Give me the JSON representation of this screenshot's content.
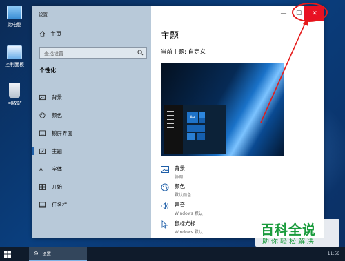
{
  "desktop": {
    "icons": [
      {
        "label": "此电脑",
        "icon": "computer-icon"
      },
      {
        "label": "控制面板",
        "icon": "control-panel-icon"
      },
      {
        "label": "回收站",
        "icon": "recycle-bin-icon"
      }
    ]
  },
  "window": {
    "title": "设置",
    "controls": {
      "minimize": "—",
      "maximize": "☐",
      "close": "✕"
    }
  },
  "sidebar": {
    "home_label": "主页",
    "search_placeholder": "查找设置",
    "category": "个性化",
    "items": [
      {
        "label": "背景",
        "icon": "image-icon"
      },
      {
        "label": "颜色",
        "icon": "palette-icon"
      },
      {
        "label": "锁屏界面",
        "icon": "lock-screen-icon"
      },
      {
        "label": "主题",
        "icon": "theme-icon",
        "active": true
      },
      {
        "label": "字体",
        "icon": "font-icon"
      },
      {
        "label": "开始",
        "icon": "start-icon"
      },
      {
        "label": "任务栏",
        "icon": "taskbar-icon"
      }
    ]
  },
  "content": {
    "title": "主题",
    "current_theme": "当前主题: 自定义",
    "preview_text": "Aa",
    "settings": [
      {
        "label": "背景",
        "value": "协调",
        "icon": "image-icon"
      },
      {
        "label": "颜色",
        "value": "默认颜色",
        "icon": "palette-icon"
      },
      {
        "label": "声音",
        "value": "Windows 默认",
        "icon": "speaker-icon"
      },
      {
        "label": "鼠标光标",
        "value": "Windows 默认",
        "icon": "cursor-icon"
      }
    ]
  },
  "taskbar": {
    "app_label": "设置",
    "time": "11:56"
  },
  "watermark": {
    "big": "百科全说",
    "small": "助你轻松解决"
  },
  "colors": {
    "accent": "#1f5fa8",
    "close": "#e81123",
    "annotation": "#e51a1a",
    "watermark": "#1a9b3c"
  }
}
